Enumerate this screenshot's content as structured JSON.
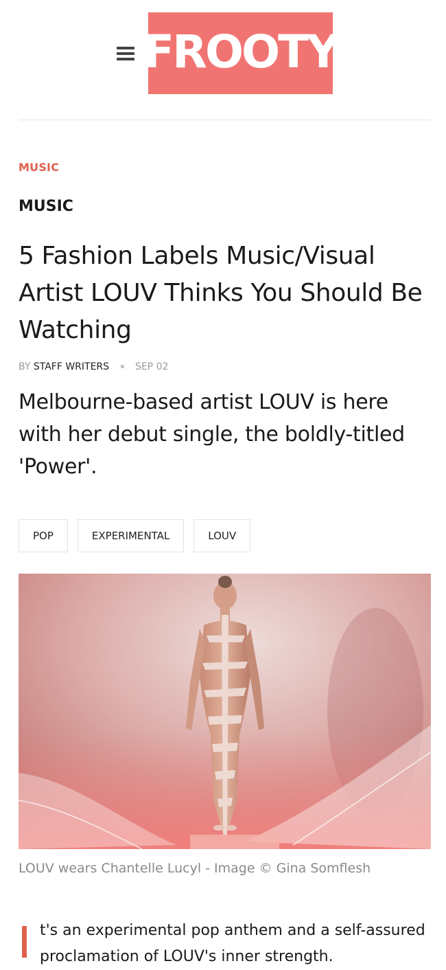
{
  "header": {
    "logo_text": "FROOTY",
    "menu_icon": "hamburger-menu-icon",
    "logo_color": "#f07572"
  },
  "article": {
    "category_link": "MUSIC",
    "section_label": "MUSIC",
    "title": "5 Fashion Labels Music/Visual Artist LOUV Thinks You Should Be Watching",
    "byline": {
      "by": "BY",
      "author": "STAFF WRITERS",
      "date": "SEP 02"
    },
    "standfirst": "Melbourne-based artist LOUV is here with her debut single, the boldly-titled 'Power'.",
    "tags": [
      "POP",
      "EXPERIMENTAL",
      "LOUV"
    ],
    "image_caption": "LOUV wears Chantelle Lucyl - Image © Gina Somflesh",
    "body_first_paragraph": "t's an experimental pop anthem and a self-assured proclamation of LOUV's inner strength.",
    "accent_color": "#e0604f"
  }
}
